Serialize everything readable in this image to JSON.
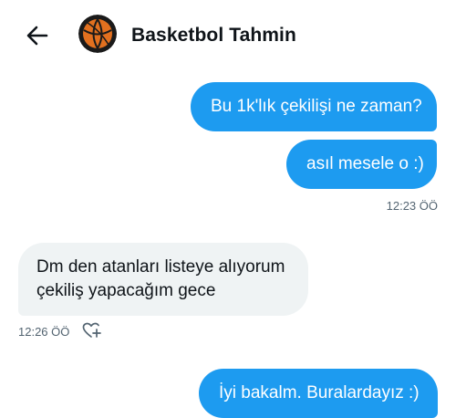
{
  "header": {
    "title": "Basketbol Tahmin",
    "back_icon": "arrow-left-icon",
    "avatar_icon": "basketball-icon"
  },
  "messages": [
    {
      "direction": "sent",
      "text": "Bu 1k'lık çekilişi ne zaman?"
    },
    {
      "direction": "sent",
      "text": "asıl mesele o :)",
      "time": "12:23 ÖÖ"
    },
    {
      "direction": "received",
      "lines": [
        "Dm den atanları listeye alıyorum",
        "çekiliş yapacağım gece"
      ],
      "time": "12:26 ÖÖ"
    },
    {
      "direction": "sent",
      "text": "İyi bakalm. Buralardayız :)"
    }
  ],
  "reaction_icon": "heart-plus-icon",
  "colors": {
    "sent_bubble": "#1d9bf0",
    "received_bubble": "#eff3f4",
    "timestamp": "#536471"
  }
}
